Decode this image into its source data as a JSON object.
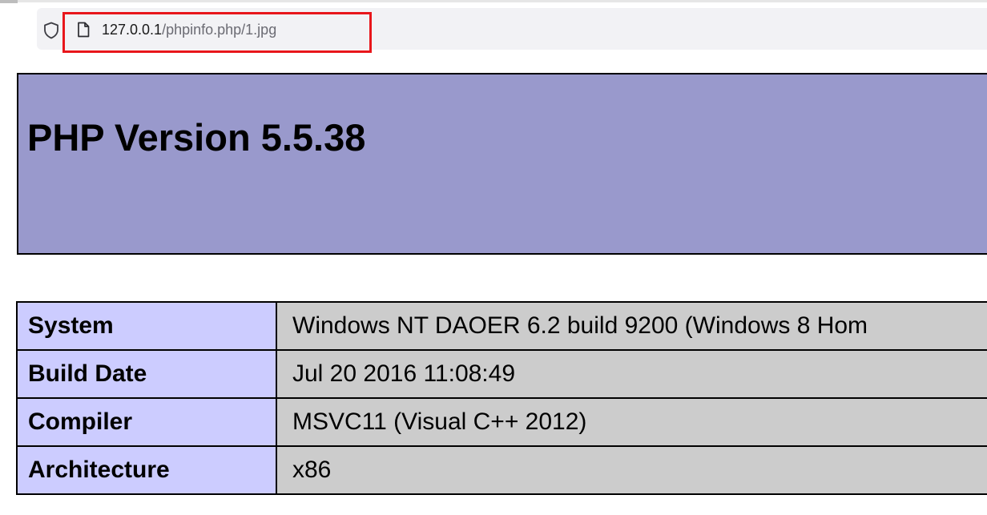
{
  "browser": {
    "url_host": "127.0.0.1",
    "url_path": "/phpinfo.php/1.jpg",
    "highlight_color": "#e8161b"
  },
  "page": {
    "title": "PHP Version 5.5.38",
    "header_color": "#9999cc",
    "key_cell_color": "#ccccff",
    "value_cell_color": "#cccccc"
  },
  "info_rows": [
    {
      "key": "System",
      "value": "Windows NT DAOER 6.2 build 9200 (Windows 8 Hom"
    },
    {
      "key": "Build Date",
      "value": "Jul 20 2016 11:08:49"
    },
    {
      "key": "Compiler",
      "value": "MSVC11 (Visual C++ 2012)"
    },
    {
      "key": "Architecture",
      "value": "x86"
    }
  ]
}
